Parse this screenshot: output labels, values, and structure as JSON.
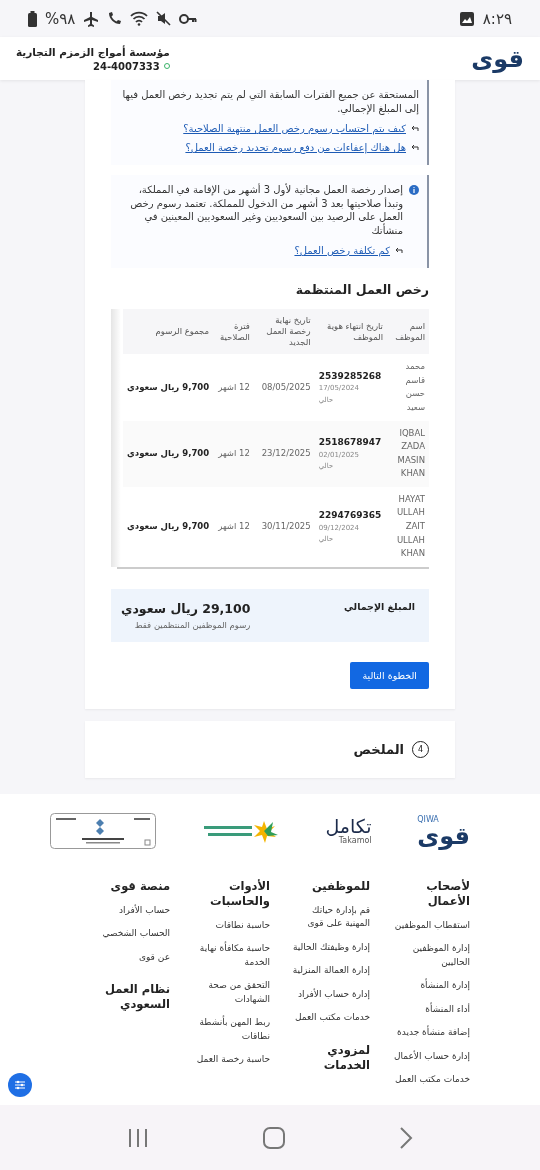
{
  "status_bar": {
    "time": "٨:٢٩",
    "battery": "%٩٨"
  },
  "header": {
    "logo": "قوى",
    "company": "مؤسسة أمواج الزمزم التجارية",
    "number": "24-4007333",
    "online": true
  },
  "info_boxes": [
    {
      "icon": false,
      "text": "المستحقة عن جميع الفترات السابقة التي لم يتم تجديد رخص العمل فيها إلى المبلغ الإجمالي.",
      "links": [
        "كيف يتم احتساب رسوم رخص العمل منتهية الصلاحية؟",
        "هل هناك إعفاءات من دفع رسوم تجديد رخصة العمل؟"
      ]
    },
    {
      "icon": true,
      "text": "إصدار رخصة العمل مجانية لأول 3 أشهر من الإقامة في المملكة، وتبدأ صلاحيتها بعد 3 أشهر من الدخول للمملكة. تعتمد رسوم رخص العمل على الرصيد بين السعوديين وغير السعوديين المعينين في منشأتك",
      "links": [
        "كم تكلفة رخص العمل؟"
      ]
    }
  ],
  "section_title": "رخص العمل المنتظمة",
  "table": {
    "columns": [
      "اسم الموظف",
      "تاريخ انتهاء هوية الموظف",
      "تاريخ نهاية رخصة العمل الجديد",
      "فترة الصلاحية",
      "مجموع الرسوم"
    ],
    "rows": [
      {
        "name": "محمد قاسم حسن سعيد",
        "id": "2539285268",
        "id_expiry": "17/05/2024",
        "id_note": "حالي",
        "end_date": "08/05/2025",
        "period": "12 اشهر",
        "total": "9,700 ريال سعودي"
      },
      {
        "name": "IQBAL ZADA MASIN KHAN",
        "id": "2518678947",
        "id_expiry": "02/01/2025",
        "id_note": "حالي",
        "end_date": "23/12/2025",
        "period": "12 اشهر",
        "total": "9,700 ريال سعودي"
      },
      {
        "name": "HAYAT ULLAH ZAIT ULLAH KHAN",
        "id": "2294769365",
        "id_expiry": "09/12/2024",
        "id_note": "حالي",
        "end_date": "30/11/2025",
        "period": "12 اشهر",
        "total": "9,700 ريال سعودي"
      }
    ]
  },
  "total": {
    "label": "المبلغ الإجمالي",
    "amount": "29,100 ريال سعودي",
    "note": "رسوم الموظفين المنتظمين فقط"
  },
  "next_button": "الخطوة التالية",
  "steps": [
    {
      "number": "4",
      "title": "الملخص"
    }
  ],
  "footer": {
    "logos": [
      {
        "kind": "qiwa",
        "text": "قوى",
        "caption": "QIWA"
      },
      {
        "kind": "takamol",
        "text": "تكامل",
        "caption": "Takamol"
      },
      {
        "kind": "ministry"
      },
      {
        "kind": "registered"
      }
    ],
    "columns": [
      {
        "sections": [
          {
            "heading": "لأصحاب الأعمال",
            "links": [
              "استقطاب الموظفين",
              "إدارة الموظفين الحاليين",
              "إدارة المنشأة",
              "أداء المنشأة",
              "إضافة منشأة جديدة",
              "إدارة حساب الأعمال",
              "خدمات مكتب العمل"
            ]
          }
        ]
      },
      {
        "sections": [
          {
            "heading": "للموظفين",
            "links": [
              "قم بإدارة حياتك المهنية على قوى",
              "إدارة وظيفتك الحالية",
              "إدارة العمالة المنزلية",
              "إدارة حساب الأفراد",
              "خدمات مكتب العمل"
            ]
          },
          {
            "heading": "لمزودي الخدمات"
          }
        ]
      },
      {
        "sections": [
          {
            "heading": "الأدوات والحاسبات",
            "links": [
              "حاسبة نطاقات",
              "حاسبة مكافأة نهاية الخدمة",
              "التحقق من صحة الشهادات",
              "ربط المهن بأنشطة نطاقات",
              "حاسبة رخصة العمل"
            ]
          }
        ]
      },
      {
        "sections": [
          {
            "heading": "منصة قوى",
            "links": [
              "حساب الأفراد",
              "الحساب الشخصي",
              "عن قوى"
            ]
          },
          {
            "heading": "نظام العمل السعودي"
          }
        ]
      }
    ]
  }
}
